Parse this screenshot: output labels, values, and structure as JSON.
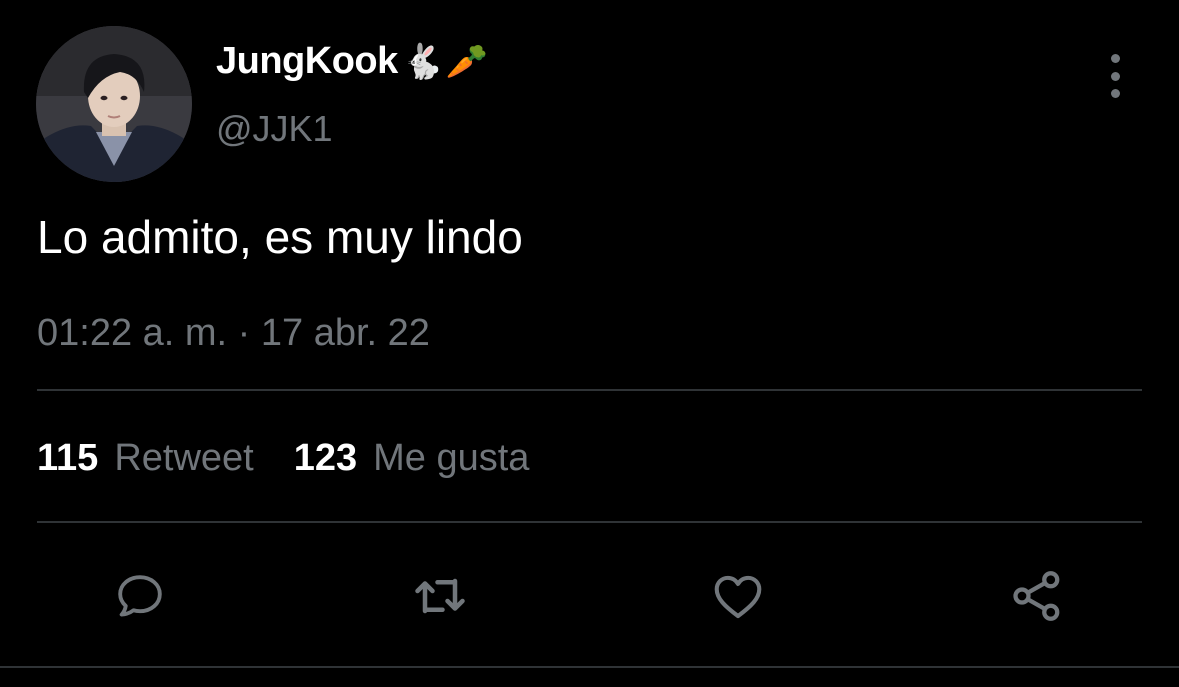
{
  "user": {
    "display_name": "JungKook",
    "name_emojis": [
      "🐇",
      "🥕"
    ],
    "handle": "@JJK1"
  },
  "tweet": {
    "text": "Lo admito, es muy lindo",
    "timestamp": "01:22 a. m. · 17 abr. 22"
  },
  "stats": {
    "retweets": {
      "count": "115",
      "label": "Retweet"
    },
    "likes": {
      "count": "123",
      "label": "Me gusta"
    }
  },
  "actions": {
    "reply_icon": "comment-icon",
    "retweet_icon": "retweet-icon",
    "like_icon": "heart-icon",
    "share_icon": "share-icon",
    "more_icon": "more-vertical-icon"
  },
  "colors": {
    "background": "#000000",
    "primary_text": "#ffffff",
    "secondary_text": "#71767b",
    "divider": "#2f3336",
    "icon": "#71767b"
  }
}
